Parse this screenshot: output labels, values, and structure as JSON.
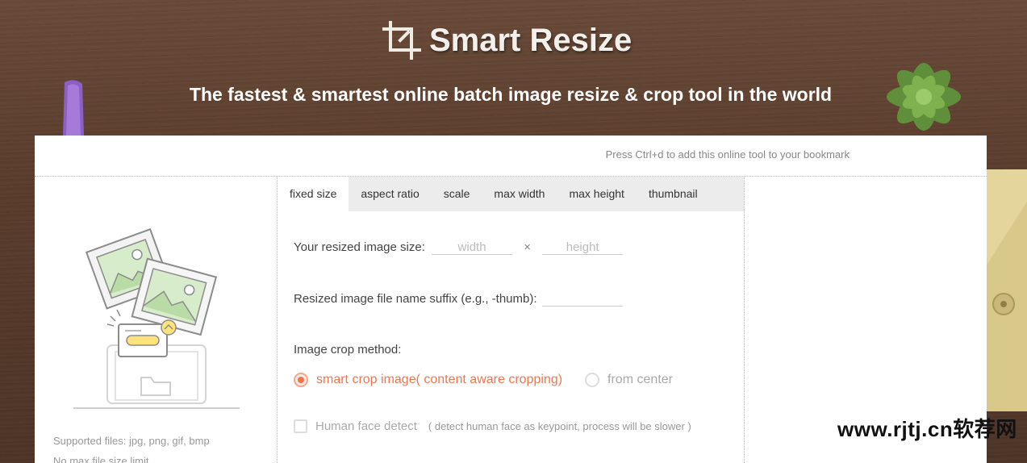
{
  "header": {
    "app_name": "Smart Resize",
    "tagline": "The fastest & smartest online batch image resize & crop tool in the world"
  },
  "bookmark_tip": "Press Ctrl+d to add this online tool to your bookmark",
  "tabs": [
    {
      "label": "fixed size",
      "active": true
    },
    {
      "label": "aspect ratio",
      "active": false
    },
    {
      "label": "scale",
      "active": false
    },
    {
      "label": "max width",
      "active": false
    },
    {
      "label": "max height",
      "active": false
    },
    {
      "label": "thumbnail",
      "active": false
    }
  ],
  "form": {
    "size_label": "Your resized image size:",
    "width_placeholder": "width",
    "times": "×",
    "height_placeholder": "height",
    "suffix_label": "Resized image file name suffix (e.g., -thumb):",
    "suffix_value": "",
    "crop_label": "Image crop method:",
    "crop_smart": "smart crop image( content aware cropping)",
    "crop_center": "from center",
    "face_label": "Human face detect",
    "face_hint": "( detect human face as keypoint, process will be slower )"
  },
  "upload": {
    "supported": "Supported files: jpg, png, gif, bmp",
    "size_limit": "No max file size limit"
  },
  "watermark": "www.rjtj.cn软荐网",
  "colors": {
    "accent": "#f0754f",
    "tab_bar": "#ececec"
  }
}
